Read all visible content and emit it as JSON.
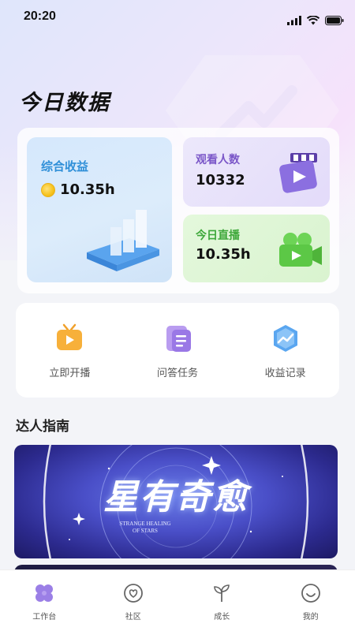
{
  "status_bar": {
    "time": "20:20",
    "icons": [
      "signal-icon",
      "wifi-icon",
      "battery-icon"
    ]
  },
  "page": {
    "title": "今日数据"
  },
  "stats": {
    "earnings": {
      "label": "综合收益",
      "value": "10.35h",
      "icon": "coin-icon"
    },
    "viewers": {
      "label": "观看人数",
      "value": "10332",
      "icon": "video-clapper-icon"
    },
    "live": {
      "label": "今日直播",
      "value": "10.35h",
      "icon": "camera-icon"
    }
  },
  "actions": [
    {
      "label": "立即开播",
      "icon": "tv-play-icon"
    },
    {
      "label": "问答任务",
      "icon": "task-list-icon"
    },
    {
      "label": "收益记录",
      "icon": "chart-hex-icon"
    }
  ],
  "guide": {
    "title": "达人指南",
    "banner": {
      "title": "星有奇愈",
      "subtitle_line1": "STRANGE HEALING",
      "subtitle_line2": "OF STARS"
    }
  },
  "bottom_nav": [
    {
      "label": "工作台",
      "icon": "clover-icon",
      "active": true
    },
    {
      "label": "社区",
      "icon": "heart-shield-icon",
      "active": false
    },
    {
      "label": "成长",
      "icon": "sprout-icon",
      "active": false
    },
    {
      "label": "我的",
      "icon": "smiley-icon",
      "active": false
    }
  ],
  "colors": {
    "accent_purple": "#8b6fe0",
    "blue": "#2f8fd8",
    "green": "#3ea83a"
  }
}
